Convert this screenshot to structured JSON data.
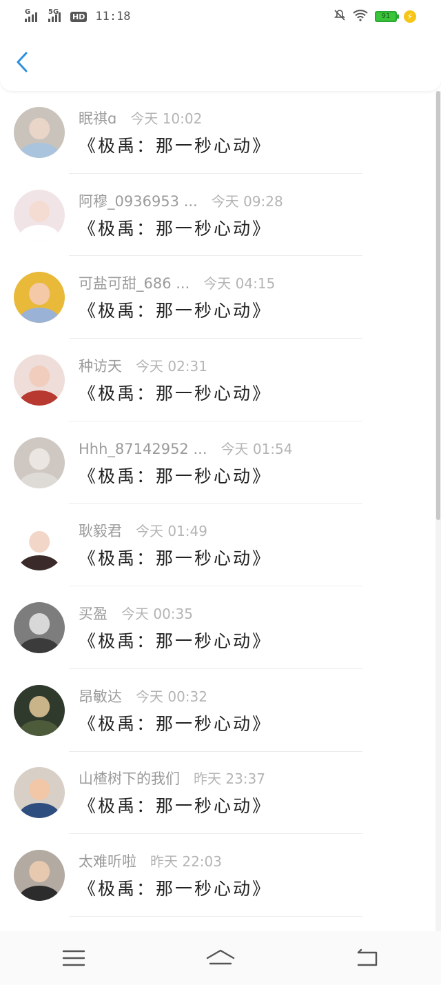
{
  "status_bar": {
    "sim1": "G",
    "sim2": "5G",
    "hd": "HD",
    "time": "11:18",
    "battery": "91"
  },
  "colors": {
    "accent": "#2b8fe0",
    "name": "#9b9b9b",
    "title": "#222222"
  },
  "icons": {
    "back": "chevron-left-icon",
    "menu": "menu-icon",
    "home": "home-icon",
    "return": "return-icon"
  },
  "comments": [
    {
      "name": "眠祺ɑ",
      "time": "今天 10:02",
      "text": "《极禹：那一秒心动》"
    },
    {
      "name": "阿穆_0936953 ...",
      "time": "今天 09:28",
      "text": "《极禹：那一秒心动》"
    },
    {
      "name": "可盐可甜_686 ...",
      "time": "今天 04:15",
      "text": "《极禹：那一秒心动》"
    },
    {
      "name": "种访天",
      "time": "今天 02:31",
      "text": "《极禹：那一秒心动》"
    },
    {
      "name": "Hhh_87142952 ...",
      "time": "今天 01:54",
      "text": "《极禹：那一秒心动》"
    },
    {
      "name": "耿毅君",
      "time": "今天 01:49",
      "text": "《极禹：那一秒心动》"
    },
    {
      "name": "买盈",
      "time": "今天 00:35",
      "text": "《极禹：那一秒心动》"
    },
    {
      "name": "昂敏达",
      "time": "今天 00:32",
      "text": "《极禹：那一秒心动》"
    },
    {
      "name": "山楂树下的我们",
      "time": "昨天 23:37",
      "text": "《极禹：那一秒心动》"
    },
    {
      "name": "太难听啦",
      "time": "昨天 22:03",
      "text": "《极禹：那一秒心动》"
    }
  ],
  "avatars": [
    {
      "bg": "#c9c3bc",
      "face": "#e9d6c8",
      "body": "#a9c4dc"
    },
    {
      "bg": "#f1e4e6",
      "face": "#f4dcd3",
      "body": "#ffffff"
    },
    {
      "bg": "#e9b93a",
      "face": "#f3c9a8",
      "body": "#9ab2d6"
    },
    {
      "bg": "#eeddd8",
      "face": "#f0cdbd",
      "body": "#b8392f"
    },
    {
      "bg": "#cfc8c2",
      "face": "#ebe6e1",
      "body": "#dedad6"
    },
    {
      "bg": "#ffffff",
      "face": "#f2d6c8",
      "body": "#3a2a2a"
    },
    {
      "bg": "#7d7d7d",
      "face": "#d8d8d8",
      "body": "#3b3b3b"
    },
    {
      "bg": "#2f3a2c",
      "face": "#c9b48a",
      "body": "#4d5b3b"
    },
    {
      "bg": "#d8cfc6",
      "face": "#f1c7a8",
      "body": "#2d4e7e"
    },
    {
      "bg": "#b3aaa2",
      "face": "#e7c9b0",
      "body": "#2c2c2c"
    }
  ]
}
